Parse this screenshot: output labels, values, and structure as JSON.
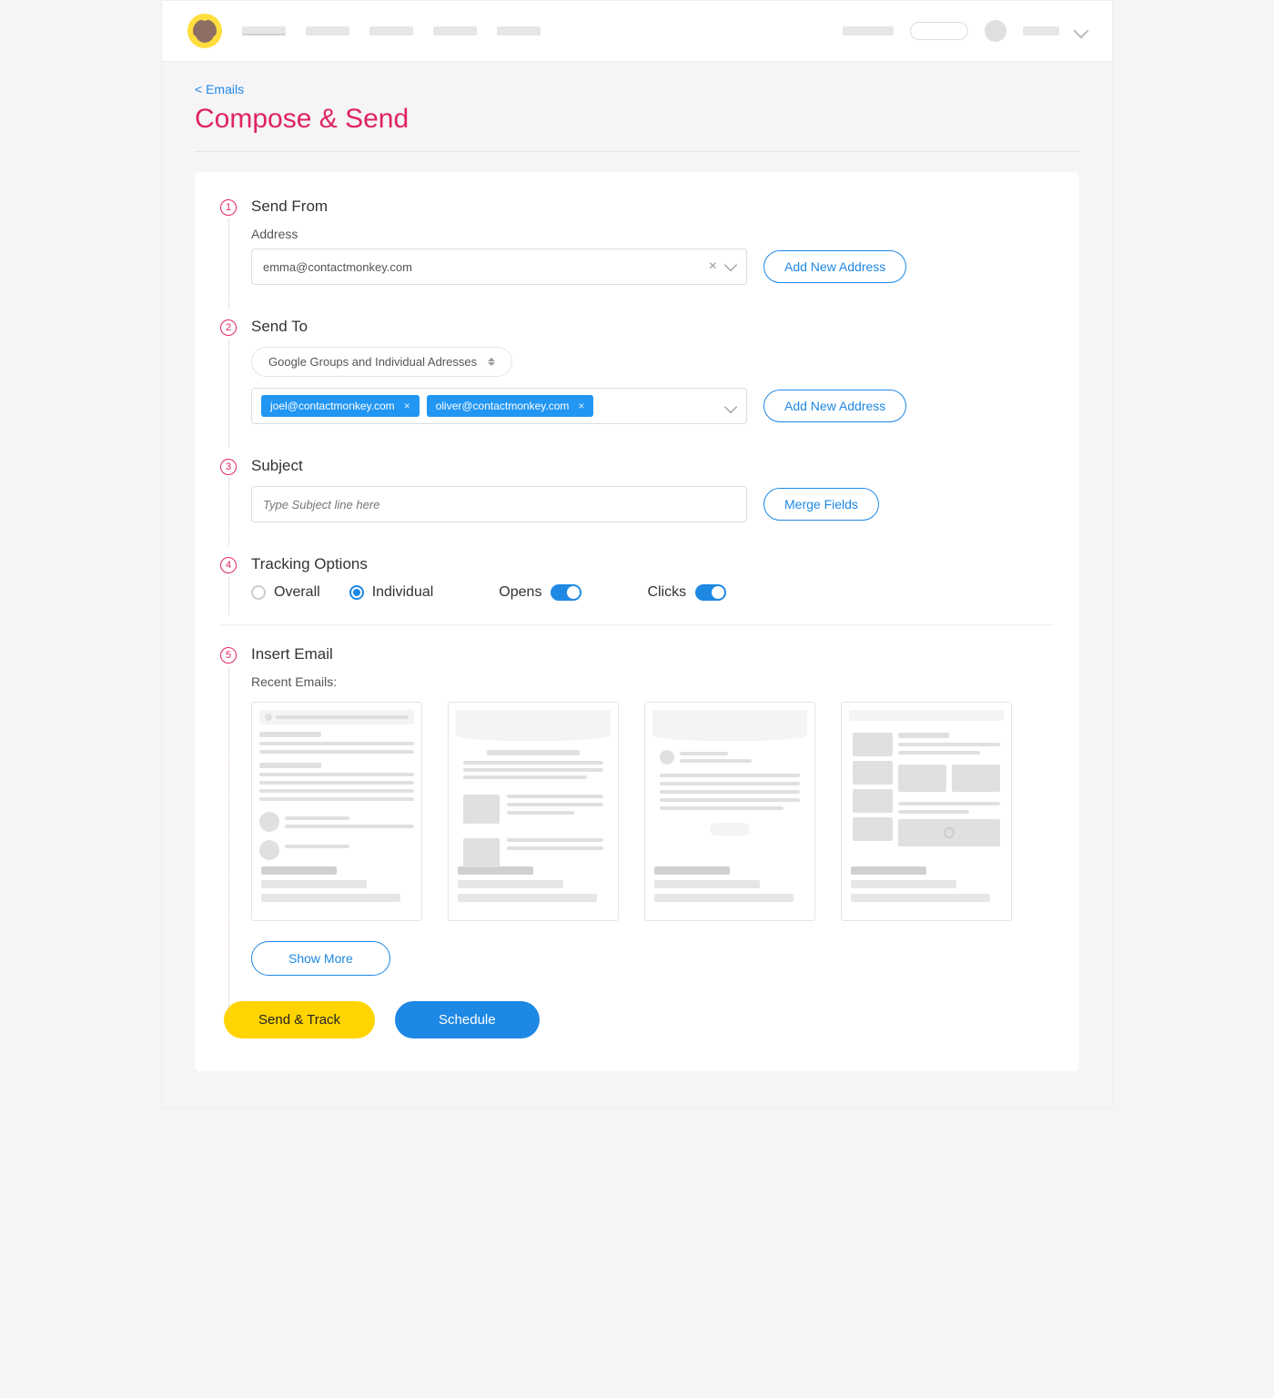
{
  "breadcrumb": "< Emails",
  "page_title": "Compose & Send",
  "steps": {
    "s1": {
      "num": "1",
      "title": "Send From",
      "address_label": "Address",
      "address_value": "emma@contactmonkey.com",
      "add_btn": "Add New Address"
    },
    "s2": {
      "num": "2",
      "title": "Send To",
      "mode": "Google Groups and Individual Adresses",
      "chips": [
        "joel@contactmonkey.com",
        "oliver@contactmonkey.com"
      ],
      "add_btn": "Add New Address"
    },
    "s3": {
      "num": "3",
      "title": "Subject",
      "placeholder": "Type Subject line here",
      "merge_btn": "Merge Fields"
    },
    "s4": {
      "num": "4",
      "title": "Tracking Options",
      "overall": "Overall",
      "individual": "Individual",
      "opens": "Opens",
      "clicks": "Clicks"
    },
    "s5": {
      "num": "5",
      "title": "Insert Email",
      "recent": "Recent Emails:",
      "show_more": "Show More"
    }
  },
  "actions": {
    "send": "Send & Track",
    "schedule": "Schedule"
  }
}
